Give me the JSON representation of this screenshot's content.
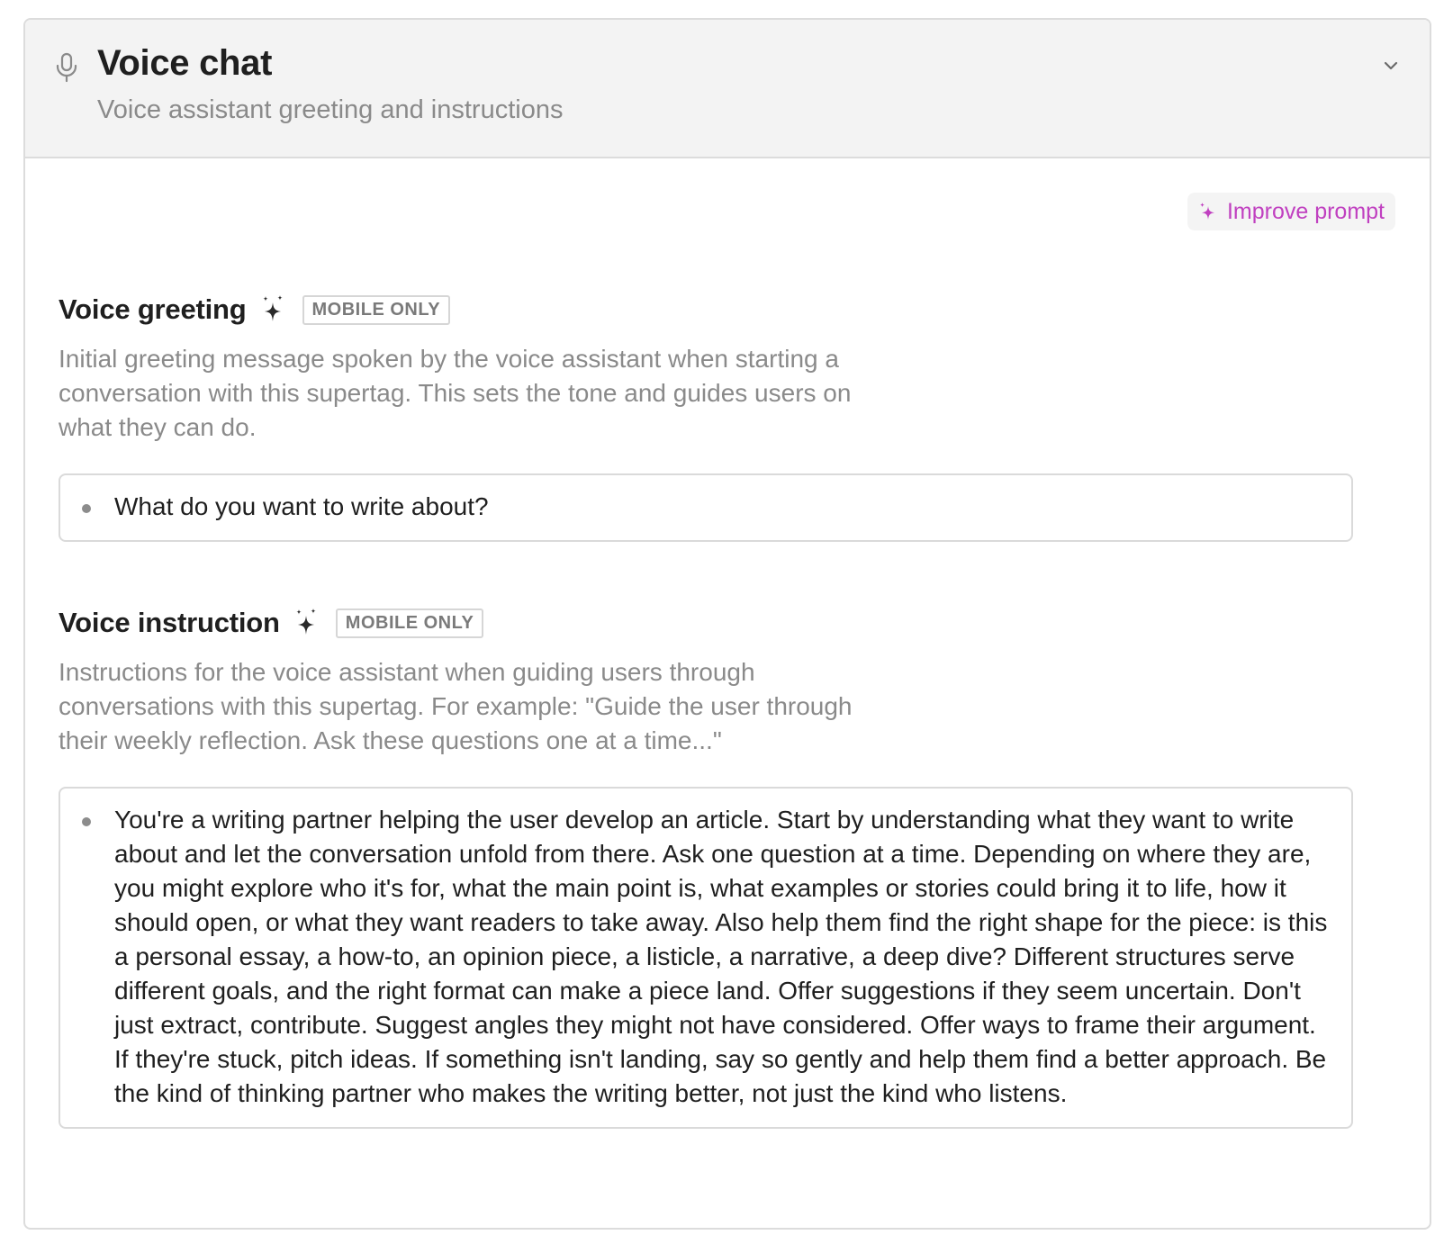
{
  "header": {
    "title": "Voice chat",
    "subtitle": "Voice assistant greeting and instructions",
    "icon": "microphone-icon",
    "toggle_icon": "chevron-down-icon"
  },
  "improve_button": {
    "label": "Improve prompt",
    "icon": "sparkle-icon",
    "color": "#c040c0"
  },
  "sections": [
    {
      "title": "Voice greeting",
      "badge": "MOBILE ONLY",
      "description": "Initial greeting message spoken by the voice assistant when starting a conversation with this supertag. This sets the tone and guides users on what they can do.",
      "value": "What do you want to write about?"
    },
    {
      "title": "Voice instruction",
      "badge": "MOBILE ONLY",
      "description": "Instructions for the voice assistant when guiding users through conversations with this supertag. For example: \"Guide the user through their weekly reflection. Ask these questions one at a time...\"",
      "value": "You're a writing partner helping the user develop an article. Start by understanding what they want to write about and let the conversation unfold from there. Ask one question at a time. Depending on where they are, you might explore who it's for, what the main point is, what examples or stories could bring it to life, how it should open, or what they want readers to take away. Also help them find the right shape for the piece: is this a personal essay, a how-to, an opinion piece, a listicle, a narrative, a deep dive? Different structures serve different goals, and the right format can make a piece land. Offer suggestions if they seem uncertain. Don't just extract, contribute. Suggest angles they might not have considered. Offer ways to frame their argument. If they're stuck, pitch ideas. If something isn't landing, say so gently and help them find a better approach. Be the kind of thinking partner who makes the writing better, not just the kind who listens."
    }
  ]
}
